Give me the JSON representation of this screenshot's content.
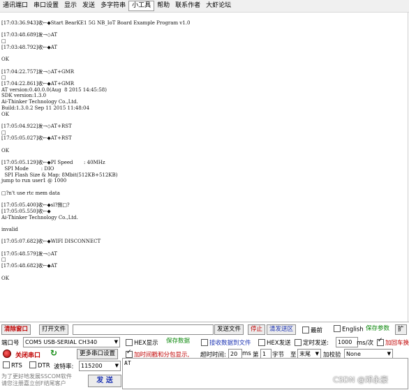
{
  "menu": [
    "通讯端口",
    "串口设置",
    "显示",
    "发送",
    "多字符串",
    "小工具",
    "帮助",
    "联系作者",
    "大虾论坛"
  ],
  "log_lines": [
    "[17:03:36.943]收←◆Start BearKE1 5G NB_IoT Board Example Program v1.0",
    "",
    "[17:03:48.689]发→◇AT",
    "□",
    "[17:03:48.792]收←◆AT",
    "",
    "OK",
    "",
    "[17:04:22.757]发→◇AT+GMR",
    "□",
    "[17:04:22.861]收←◆AT+GMR",
    "AT version:0.40.0.0(Aug  8 2015 14:45:58)",
    "SDK version:1.3.0",
    "Ai-Thinker Technology Co.,Ltd.",
    "Build:1.3.0.2 Sep 11 2015 11:48:04",
    "OK",
    "",
    "[17:05:04.922]发→◇AT+RST",
    "□",
    "[17:05:05.027]收←◆AT+RST",
    "",
    "OK",
    "",
    "[17:05:05.129]收←◆PI Speed       : 40MHz",
    "  SPI Mode        : DIO",
    "  SPI Flash Size & Map: 8Mbit(512KB+512KB)",
    "jump to run user1 @ 1000",
    "",
    "□?n't use rtc mem data",
    "",
    "[17:05:05.400]收←◆sl?捌□?",
    "[17:05:05.550]收←◆",
    "Ai-Thinker Technology Co.,Ltd.",
    "",
    "invalid",
    "",
    "[17:05:07.682]收←◆WIFI DISCONNECT",
    "",
    "[17:05:48.579]发→◇AT",
    "□",
    "[17:05:48.682]收←◆AT",
    "",
    "OK"
  ],
  "toolbar1": {
    "clear_window": "清除窗口",
    "open_file": "打开文件",
    "send_file": "发送文件",
    "stop": "停止",
    "clear_send": "清发送区",
    "top_most": "最前",
    "english": "English",
    "save_params": "保存参数",
    "expand": "扩"
  },
  "toolbar2": {
    "port_label": "端口号",
    "port_value": "COM5 USB-SERIAL CH340",
    "hex_display": "HEX显示",
    "save_data": "保存数据",
    "recv_to_file": "接收数据到文件",
    "hex_send": "HEX发送",
    "timed_send": "定时发送:",
    "interval": "1000",
    "interval_unit": "ms/次",
    "add_crlf": "加回车换"
  },
  "toolbar3": {
    "close_port": "关闭串口",
    "more_settings": "更多串口设置",
    "add_timestamp": "加时间戳和分包显示,",
    "timeout_label": "超时时间:",
    "timeout_value": "20",
    "timeout_unit": "ms",
    "nth_label": "第",
    "nth_value": "1",
    "byte_label": "字节",
    "to_label": "至",
    "end_value": "末尾",
    "checksum_label": "加校验",
    "checksum_value": "None"
  },
  "toolbar4": {
    "rts": "RTS",
    "dtr": "DTR",
    "baud_label": "波特率:",
    "baud_value": "115200"
  },
  "send_area_text": "AT",
  "promo_line1": "为了更好地发展SSCOM软件",
  "promo_line2": "请您注册嘉立创F结尾客户",
  "send_button": "发 送",
  "watermark": "CSDN @邓永豪"
}
